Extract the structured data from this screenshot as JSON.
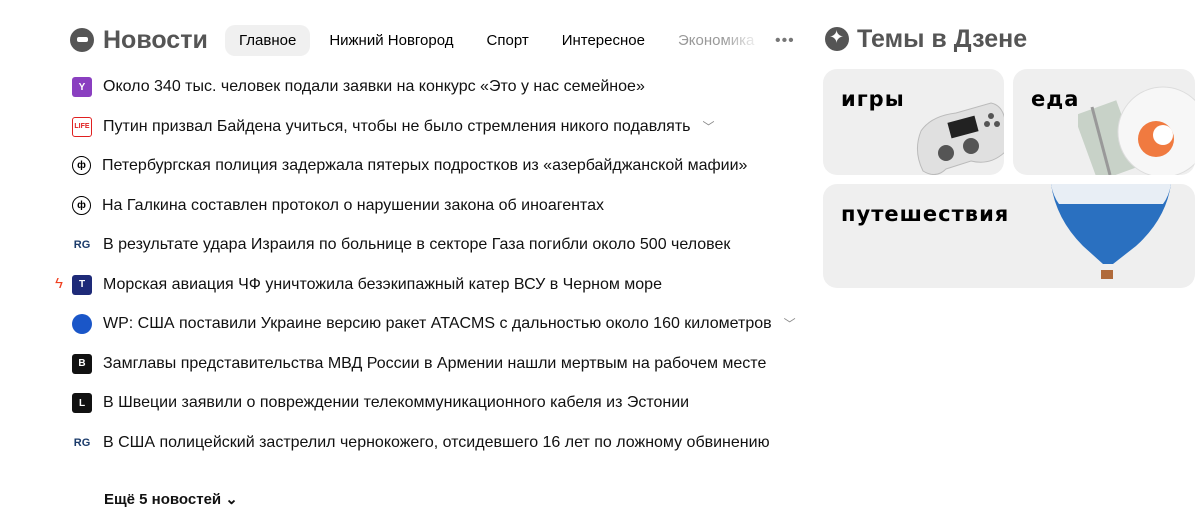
{
  "header": {
    "brand": "Новости",
    "tabs": [
      "Главное",
      "Нижний Новгород",
      "Спорт",
      "Интересное",
      "Экономика"
    ],
    "more": "•••"
  },
  "news": [
    {
      "source_icon": "yandex-y-icon",
      "icon_text": "Y",
      "color": "#8a3fc0",
      "title": "Около 340 тыс. человек подали заявки на конкурс «Это у нас семейное»",
      "expand": false,
      "urgent": false
    },
    {
      "source_icon": "life-icon",
      "icon_text": "LIFE",
      "color": "#e02020",
      "title": "Путин призвал Байдена учиться, чтобы не было стремления никого подавлять",
      "expand": true,
      "urgent": false
    },
    {
      "source_icon": "fontanka-icon",
      "icon_text": "ф",
      "color": "#000000",
      "title": "Петербургская полиция задержала пятерых подростков из «азербайджанской мафии»",
      "expand": false,
      "urgent": false
    },
    {
      "source_icon": "fontanka-icon",
      "icon_text": "ф",
      "color": "#000000",
      "title": "На Галкина составлен протокол о нарушении закона об иноагентах",
      "expand": false,
      "urgent": false
    },
    {
      "source_icon": "rg-icon",
      "icon_text": "RG",
      "color": "#1a3a6a",
      "title": "В результате удара Израиля по больнице в секторе Газа погибли около 500 человек",
      "expand": false,
      "urgent": false
    },
    {
      "source_icon": "tass-icon",
      "icon_text": "T",
      "color": "#1e2a78",
      "title": "Морская авиация ЧФ уничтожила безэкипажный катер ВСУ в Черном море",
      "expand": false,
      "urgent": true
    },
    {
      "source_icon": "gazeta-icon",
      "icon_text": "",
      "color": "#1a56c8",
      "title": "WP: США поставили Украине версию ракет ATACMS с дальностью около 160 километров",
      "expand": true,
      "urgent": false
    },
    {
      "source_icon": "vedomosti-icon",
      "icon_text": "B",
      "color": "#111111",
      "title": "Замглавы представительства МВД России в Армении нашли мертвым на рабочем месте",
      "expand": false,
      "urgent": false
    },
    {
      "source_icon": "lenta-icon",
      "icon_text": "L",
      "color": "#111111",
      "title": "В Швеции заявили о повреждении телекоммуникационного кабеля из Эстонии",
      "expand": false,
      "urgent": false
    },
    {
      "source_icon": "rg-icon",
      "icon_text": "RG",
      "color": "#1a3a6a",
      "title": "В США полицейский застрелил чернокожего, отсидевшего 16 лет по ложному обвинению",
      "expand": false,
      "urgent": false
    }
  ],
  "more_news": "Ещё 5 новостей ⌄",
  "zen": {
    "title": "Темы в Дзене",
    "cards": [
      "игры",
      "еда",
      "путешествия"
    ]
  }
}
